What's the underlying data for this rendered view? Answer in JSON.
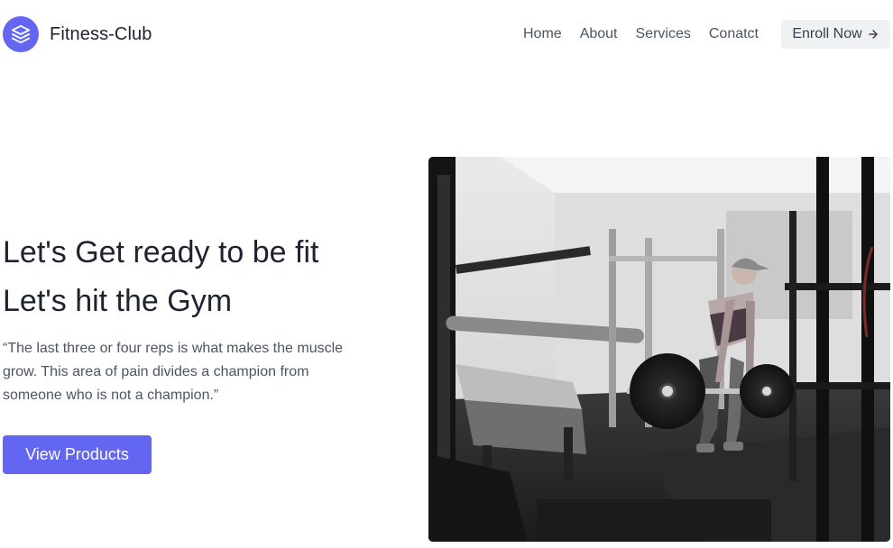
{
  "brand": {
    "name": "Fitness-Club",
    "logo_icon": "layers-icon",
    "accent": "#6366f1"
  },
  "nav": {
    "items": [
      {
        "label": "Home"
      },
      {
        "label": "About"
      },
      {
        "label": "Services"
      },
      {
        "label": "Conatct"
      }
    ],
    "enroll_label": "Enroll Now",
    "enroll_icon": "arrow-right-icon"
  },
  "hero": {
    "title_line1": "Let's Get ready to be fit",
    "title_line2": "Let's hit the Gym",
    "quote": "“The last three or four reps is what makes the muscle grow. This area of pain divides a champion from someone who is not a champion.”",
    "cta_label": "View Products",
    "image": {
      "subject": "woman-deadlifting-barbell-in-gym",
      "style": "black-and-white"
    }
  }
}
